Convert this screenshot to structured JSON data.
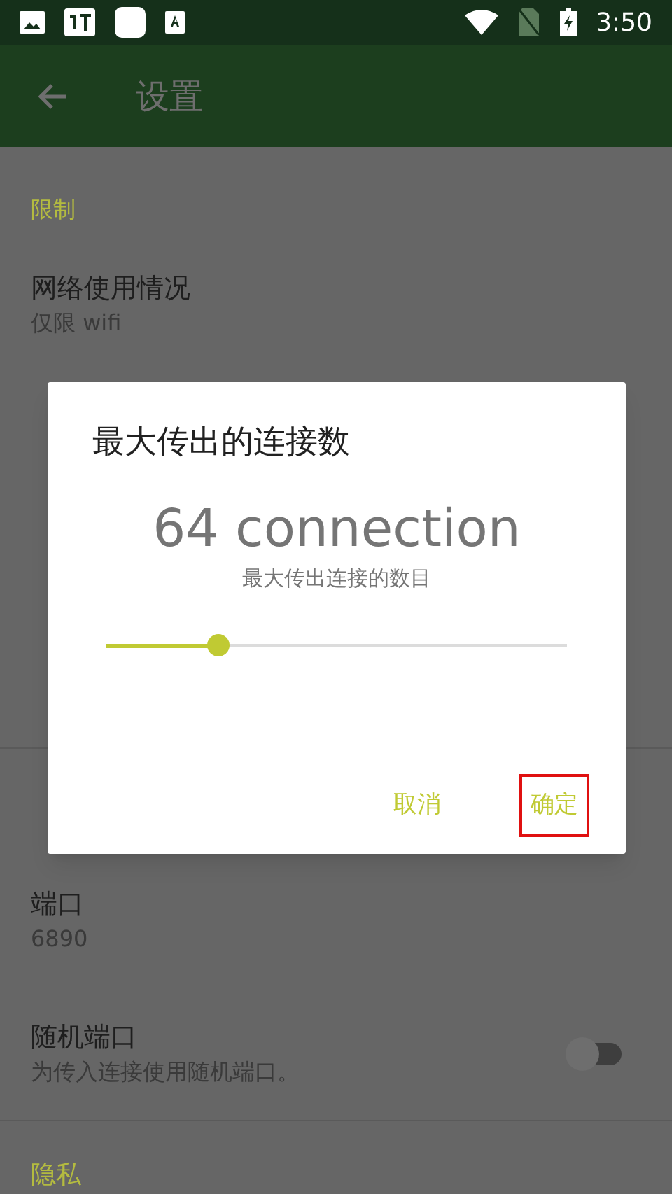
{
  "status_bar": {
    "time": "3:50"
  },
  "app_bar": {
    "title": "设置"
  },
  "sections": [
    {
      "header": "限制",
      "items": [
        {
          "kind": "text",
          "title": "网络使用情况",
          "summary": "仅限 wifi"
        }
      ]
    },
    {
      "items": [
        {
          "kind": "text",
          "title": "端口",
          "summary": "6890"
        },
        {
          "kind": "switch",
          "title": "随机端口",
          "summary": "为传入连接使用随机端口。",
          "on": false
        }
      ]
    },
    {
      "header": "隐私"
    }
  ],
  "dialog": {
    "title": "最大传出的连接数",
    "value": "64 connection",
    "caption": "最大传出连接的数目",
    "slider": {
      "level": 0.244
    },
    "buttons": [
      {
        "label": "取消",
        "highlighted": false
      },
      {
        "label": "确定",
        "highlighted": true
      }
    ]
  }
}
